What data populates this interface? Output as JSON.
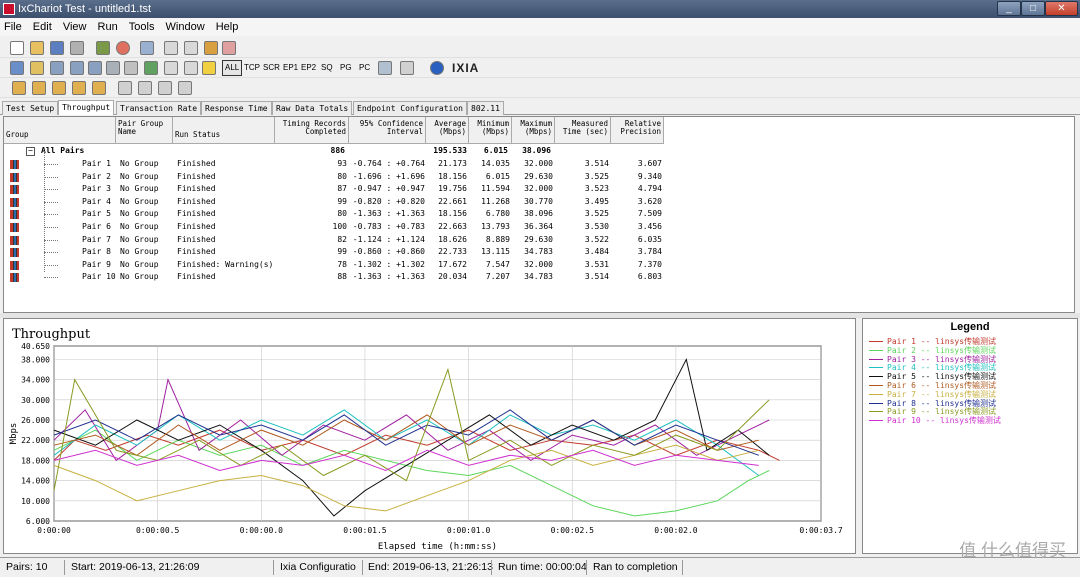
{
  "window": {
    "title": "IxChariot Test - untitled1.tst"
  },
  "menu": [
    "File",
    "Edit",
    "View",
    "Run",
    "Tools",
    "Window",
    "Help"
  ],
  "toolbar": {
    "filters": [
      "ALL",
      "TCP",
      "SCR",
      "EP1",
      "EP2",
      "SQ",
      "PG",
      "PC"
    ],
    "brand": "IXIA"
  },
  "tabs": [
    "Test Setup",
    "Throughput",
    "Transaction Rate",
    "Response Time",
    "Raw Data Totals",
    "Endpoint Configuration",
    "802.11"
  ],
  "grid": {
    "headers": {
      "group": "Group",
      "pair_group_name": "Pair Group\nName",
      "run_status": "Run Status",
      "timing_records": "Timing Records\nCompleted",
      "confidence": "95% Confidence\nInterval",
      "average": "Average\n(Mbps)",
      "minimum": "Minimum\n(Mbps)",
      "maximum": "Maximum\n(Mbps)",
      "measured_time": "Measured\nTime (sec)",
      "relative_precision": "Relative\nPrecision"
    },
    "all_pairs": {
      "label": "All Pairs",
      "records": "886",
      "average": "195.533",
      "minimum": "6.015",
      "maximum": "38.096"
    },
    "rows": [
      {
        "pair": "Pair 1",
        "group": "No Group",
        "status": "Finished",
        "records": "93",
        "ci": "-0.764 : +0.764",
        "avg": "21.173",
        "min": "14.035",
        "max": "32.000",
        "time": "3.514",
        "prec": "3.607"
      },
      {
        "pair": "Pair 2",
        "group": "No Group",
        "status": "Finished",
        "records": "80",
        "ci": "-1.696 : +1.696",
        "avg": "18.156",
        "min": "6.015",
        "max": "29.630",
        "time": "3.525",
        "prec": "9.340"
      },
      {
        "pair": "Pair 3",
        "group": "No Group",
        "status": "Finished",
        "records": "87",
        "ci": "-0.947 : +0.947",
        "avg": "19.756",
        "min": "11.594",
        "max": "32.000",
        "time": "3.523",
        "prec": "4.794"
      },
      {
        "pair": "Pair 4",
        "group": "No Group",
        "status": "Finished",
        "records": "99",
        "ci": "-0.820 : +0.820",
        "avg": "22.661",
        "min": "11.268",
        "max": "30.770",
        "time": "3.495",
        "prec": "3.620"
      },
      {
        "pair": "Pair 5",
        "group": "No Group",
        "status": "Finished",
        "records": "80",
        "ci": "-1.363 : +1.363",
        "avg": "18.156",
        "min": "6.780",
        "max": "38.096",
        "time": "3.525",
        "prec": "7.509"
      },
      {
        "pair": "Pair 6",
        "group": "No Group",
        "status": "Finished",
        "records": "100",
        "ci": "-0.783 : +0.783",
        "avg": "22.663",
        "min": "13.793",
        "max": "36.364",
        "time": "3.530",
        "prec": "3.456"
      },
      {
        "pair": "Pair 7",
        "group": "No Group",
        "status": "Finished",
        "records": "82",
        "ci": "-1.124 : +1.124",
        "avg": "18.626",
        "min": "8.889",
        "max": "29.630",
        "time": "3.522",
        "prec": "6.035"
      },
      {
        "pair": "Pair 8",
        "group": "No Group",
        "status": "Finished",
        "records": "99",
        "ci": "-0.860 : +0.860",
        "avg": "22.733",
        "min": "13.115",
        "max": "34.783",
        "time": "3.484",
        "prec": "3.784"
      },
      {
        "pair": "Pair 9",
        "group": "No Group",
        "status": "Finished: Warning(s)",
        "records": "78",
        "ci": "-1.302 : +1.302",
        "avg": "17.672",
        "min": "7.547",
        "max": "32.000",
        "time": "3.531",
        "prec": "7.370"
      },
      {
        "pair": "Pair 10",
        "group": "No Group",
        "status": "Finished",
        "records": "88",
        "ci": "-1.363 : +1.363",
        "avg": "20.034",
        "min": "7.207",
        "max": "34.783",
        "time": "3.514",
        "prec": "6.803"
      }
    ]
  },
  "chart_data": {
    "type": "line",
    "title": "Throughput",
    "xlabel": "Elapsed time (h:mm:ss)",
    "ylabel": "Mbps",
    "ylim": [
      6.0,
      40.65
    ],
    "xlim": [
      0,
      3.7
    ],
    "yticks": [
      "40.650",
      "38.000",
      "34.000",
      "30.000",
      "26.000",
      "22.000",
      "18.000",
      "14.000",
      "10.000",
      "6.000"
    ],
    "ytick_values": [
      40.65,
      38,
      34,
      30,
      26,
      22,
      18,
      14,
      10,
      6
    ],
    "xticks": [
      "0:00:00",
      "0:00:00.5",
      "0:00:00.0",
      "0:00:01.5",
      "0:00:01.0",
      "0:00:02.5",
      "0:00:02.0",
      "0:00:03.7"
    ],
    "xtick_values": [
      0,
      0.5,
      1.0,
      1.5,
      2.0,
      2.5,
      3.0,
      3.7
    ],
    "grid": true,
    "series": [
      {
        "name": "Pair 1 -- linsys传输测试",
        "color": "#c0392b",
        "points": [
          [
            0,
            18
          ],
          [
            0.1,
            22
          ],
          [
            0.25,
            20
          ],
          [
            0.45,
            23
          ],
          [
            0.6,
            21
          ],
          [
            0.8,
            24
          ],
          [
            1.0,
            20
          ],
          [
            1.2,
            22
          ],
          [
            1.4,
            19
          ],
          [
            1.6,
            23
          ],
          [
            1.8,
            21
          ],
          [
            2.0,
            24
          ],
          [
            2.2,
            20
          ],
          [
            2.4,
            22
          ],
          [
            2.6,
            21
          ],
          [
            2.8,
            23
          ],
          [
            3.0,
            19
          ],
          [
            3.2,
            22
          ],
          [
            3.4,
            20
          ],
          [
            3.5,
            18
          ]
        ]
      },
      {
        "name": "Pair 2 -- linsys传输测试",
        "color": "#5cd65c",
        "points": [
          [
            0,
            20
          ],
          [
            0.2,
            24
          ],
          [
            0.4,
            18
          ],
          [
            0.6,
            22
          ],
          [
            0.8,
            19
          ],
          [
            1.0,
            21
          ],
          [
            1.2,
            17
          ],
          [
            1.4,
            20
          ],
          [
            1.6,
            18
          ],
          [
            1.8,
            16
          ],
          [
            2.0,
            15
          ],
          [
            2.2,
            17
          ],
          [
            2.4,
            13
          ],
          [
            2.6,
            9
          ],
          [
            2.8,
            7
          ],
          [
            3.0,
            8
          ],
          [
            3.2,
            10
          ],
          [
            3.35,
            14
          ],
          [
            3.45,
            16
          ]
        ]
      },
      {
        "name": "Pair 3 -- linsys传输测试",
        "color": "#a020a0",
        "points": [
          [
            0,
            22
          ],
          [
            0.15,
            28
          ],
          [
            0.3,
            18
          ],
          [
            0.5,
            24
          ],
          [
            0.55,
            34
          ],
          [
            0.7,
            20
          ],
          [
            0.9,
            26
          ],
          [
            1.1,
            19
          ],
          [
            1.3,
            25
          ],
          [
            1.5,
            22
          ],
          [
            1.7,
            27
          ],
          [
            1.9,
            20
          ],
          [
            2.1,
            24
          ],
          [
            2.3,
            18
          ],
          [
            2.5,
            23
          ],
          [
            2.7,
            21
          ],
          [
            2.9,
            25
          ],
          [
            3.1,
            19
          ],
          [
            3.3,
            23
          ],
          [
            3.45,
            26
          ]
        ]
      },
      {
        "name": "Pair 4 -- linsys传输测试",
        "color": "#20c0c0",
        "points": [
          [
            0,
            19
          ],
          [
            0.2,
            25
          ],
          [
            0.4,
            21
          ],
          [
            0.6,
            27
          ],
          [
            0.8,
            22
          ],
          [
            1.0,
            26
          ],
          [
            1.2,
            23
          ],
          [
            1.4,
            28
          ],
          [
            1.6,
            22
          ],
          [
            1.8,
            26
          ],
          [
            2.0,
            21
          ],
          [
            2.2,
            27
          ],
          [
            2.4,
            23
          ],
          [
            2.6,
            25
          ],
          [
            2.8,
            22
          ],
          [
            3.0,
            26
          ],
          [
            3.2,
            21
          ],
          [
            3.4,
            15
          ]
        ]
      },
      {
        "name": "Pair 5 -- linsys传输测试",
        "color": "#101010",
        "points": [
          [
            0,
            24
          ],
          [
            0.2,
            21
          ],
          [
            0.4,
            26
          ],
          [
            0.6,
            22
          ],
          [
            0.8,
            25
          ],
          [
            1.0,
            20
          ],
          [
            1.2,
            14
          ],
          [
            1.35,
            7
          ],
          [
            1.5,
            12
          ],
          [
            1.7,
            17
          ],
          [
            1.9,
            22
          ],
          [
            2.1,
            27
          ],
          [
            2.3,
            21
          ],
          [
            2.5,
            25
          ],
          [
            2.7,
            22
          ],
          [
            2.9,
            26
          ],
          [
            3.05,
            38
          ],
          [
            3.15,
            20
          ],
          [
            3.3,
            24
          ],
          [
            3.45,
            19
          ]
        ]
      },
      {
        "name": "Pair 6 -- linsys传输测试",
        "color": "#b05a20",
        "points": [
          [
            0,
            21
          ],
          [
            0.2,
            23
          ],
          [
            0.4,
            19
          ],
          [
            0.6,
            25
          ],
          [
            0.8,
            20
          ],
          [
            1.0,
            24
          ],
          [
            1.2,
            21
          ],
          [
            1.4,
            26
          ],
          [
            1.6,
            22
          ],
          [
            1.8,
            27
          ],
          [
            2.0,
            21
          ],
          [
            2.2,
            25
          ],
          [
            2.4,
            22
          ],
          [
            2.6,
            26
          ],
          [
            2.8,
            21
          ],
          [
            3.0,
            24
          ],
          [
            3.2,
            20
          ],
          [
            3.4,
            22
          ]
        ]
      },
      {
        "name": "Pair 7 -- linsys传输测试",
        "color": "#c8b040",
        "points": [
          [
            0,
            17
          ],
          [
            0.2,
            14
          ],
          [
            0.4,
            10
          ],
          [
            0.6,
            12
          ],
          [
            0.8,
            14
          ],
          [
            1.0,
            15
          ],
          [
            1.2,
            13
          ],
          [
            1.4,
            9
          ],
          [
            1.6,
            8
          ],
          [
            1.8,
            11
          ],
          [
            2.0,
            14
          ],
          [
            2.2,
            18
          ],
          [
            2.4,
            20
          ],
          [
            2.6,
            17
          ],
          [
            2.8,
            19
          ],
          [
            3.0,
            21
          ],
          [
            3.2,
            18
          ],
          [
            3.4,
            20
          ]
        ]
      },
      {
        "name": "Pair 8 -- linsys传输测试",
        "color": "#203090",
        "points": [
          [
            0,
            23
          ],
          [
            0.2,
            26
          ],
          [
            0.4,
            22
          ],
          [
            0.6,
            27
          ],
          [
            0.8,
            23
          ],
          [
            1.0,
            25
          ],
          [
            1.2,
            22
          ],
          [
            1.4,
            27
          ],
          [
            1.6,
            21
          ],
          [
            1.8,
            25
          ],
          [
            2.0,
            23
          ],
          [
            2.2,
            28
          ],
          [
            2.4,
            22
          ],
          [
            2.6,
            26
          ],
          [
            2.8,
            21
          ],
          [
            3.0,
            25
          ],
          [
            3.2,
            22
          ],
          [
            3.4,
            19
          ]
        ]
      },
      {
        "name": "Pair 9 -- linsys传输测试",
        "color": "#8a9a20",
        "points": [
          [
            0,
            12
          ],
          [
            0.1,
            34
          ],
          [
            0.3,
            20
          ],
          [
            0.5,
            18
          ],
          [
            0.7,
            22
          ],
          [
            0.9,
            17
          ],
          [
            1.1,
            21
          ],
          [
            1.3,
            15
          ],
          [
            1.5,
            19
          ],
          [
            1.7,
            14
          ],
          [
            1.9,
            36
          ],
          [
            2.0,
            18
          ],
          [
            2.2,
            22
          ],
          [
            2.4,
            17
          ],
          [
            2.6,
            21
          ],
          [
            2.8,
            19
          ],
          [
            3.0,
            23
          ],
          [
            3.2,
            20
          ],
          [
            3.4,
            28
          ],
          [
            3.45,
            30
          ]
        ]
      },
      {
        "name": "Pair 10 -- linsys传输测试",
        "color": "#d030d0",
        "points": [
          [
            0,
            18
          ],
          [
            0.2,
            20
          ],
          [
            0.4,
            17
          ],
          [
            0.6,
            19
          ],
          [
            0.8,
            16
          ],
          [
            1.0,
            18
          ],
          [
            1.2,
            17
          ],
          [
            1.4,
            19
          ],
          [
            1.6,
            16
          ],
          [
            1.8,
            20
          ],
          [
            2.0,
            17
          ],
          [
            2.2,
            19
          ],
          [
            2.4,
            18
          ],
          [
            2.6,
            20
          ],
          [
            2.8,
            17
          ],
          [
            3.0,
            19
          ],
          [
            3.2,
            18
          ],
          [
            3.4,
            17
          ]
        ]
      }
    ]
  },
  "legend": {
    "title": "Legend"
  },
  "status": {
    "pairs": "Pairs: 10",
    "start": "Start: 2019-06-13, 21:26:09",
    "config": "Ixia Configuratio",
    "end": "End: 2019-06-13, 21:26:13",
    "runtime": "Run time: 00:00:04",
    "completion": "Ran to completion"
  },
  "watermark": "值 什么值得买"
}
